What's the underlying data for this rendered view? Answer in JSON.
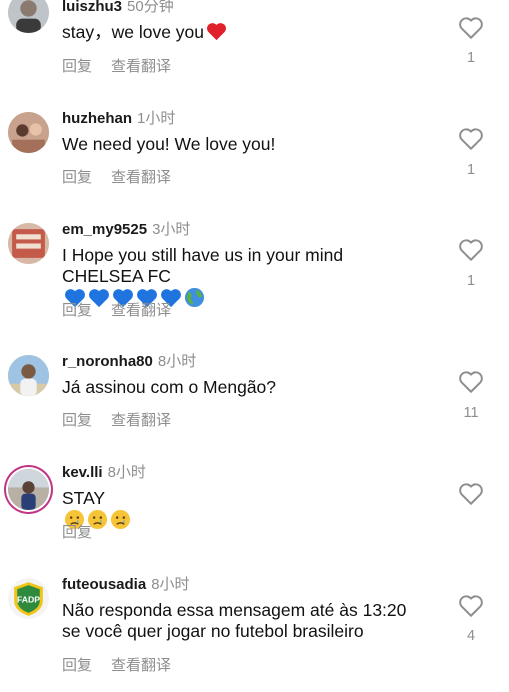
{
  "comments": [
    {
      "username": "luiszhu3",
      "time": "50分钟",
      "text": "stay，we love you",
      "likes": "1",
      "actions": {
        "reply": "回复",
        "translate": "查看翻译"
      },
      "emoji": [
        "red-heart"
      ]
    },
    {
      "username": "huzhehan",
      "time": "1小时",
      "text": "We need you! We love you!",
      "likes": "1",
      "actions": {
        "reply": "回复",
        "translate": "查看翻译"
      }
    },
    {
      "username": "em_my9525",
      "time": "3小时",
      "text": "I Hope you still have us in your mind\nCHELSEA FC",
      "likes": "1",
      "actions": {
        "reply": "回复",
        "translate": "查看翻译"
      },
      "emoji": [
        "blue-heart",
        "blue-heart",
        "blue-heart",
        "blue-heart",
        "blue-heart",
        "globe"
      ]
    },
    {
      "username": "r_noronha80",
      "time": "8小时",
      "text": "Já assinou com o Mengão?",
      "likes": "11",
      "actions": {
        "reply": "回复",
        "translate": "查看翻译"
      }
    },
    {
      "username": "kev.lli",
      "time": "8小时",
      "text": "STAY",
      "likes": "",
      "actions": {
        "reply": "回复"
      },
      "emoji": [
        "crying-face",
        "crying-face",
        "crying-face"
      ]
    },
    {
      "username": "futeousadia",
      "time": "8小时",
      "text": "Não responda essa mensagem até às 13:20\nse você quer jogar no futebol brasileiro",
      "likes": "4",
      "actions": {
        "reply": "回复",
        "translate": "查看翻译"
      },
      "avatar_text": "FADP"
    }
  ]
}
